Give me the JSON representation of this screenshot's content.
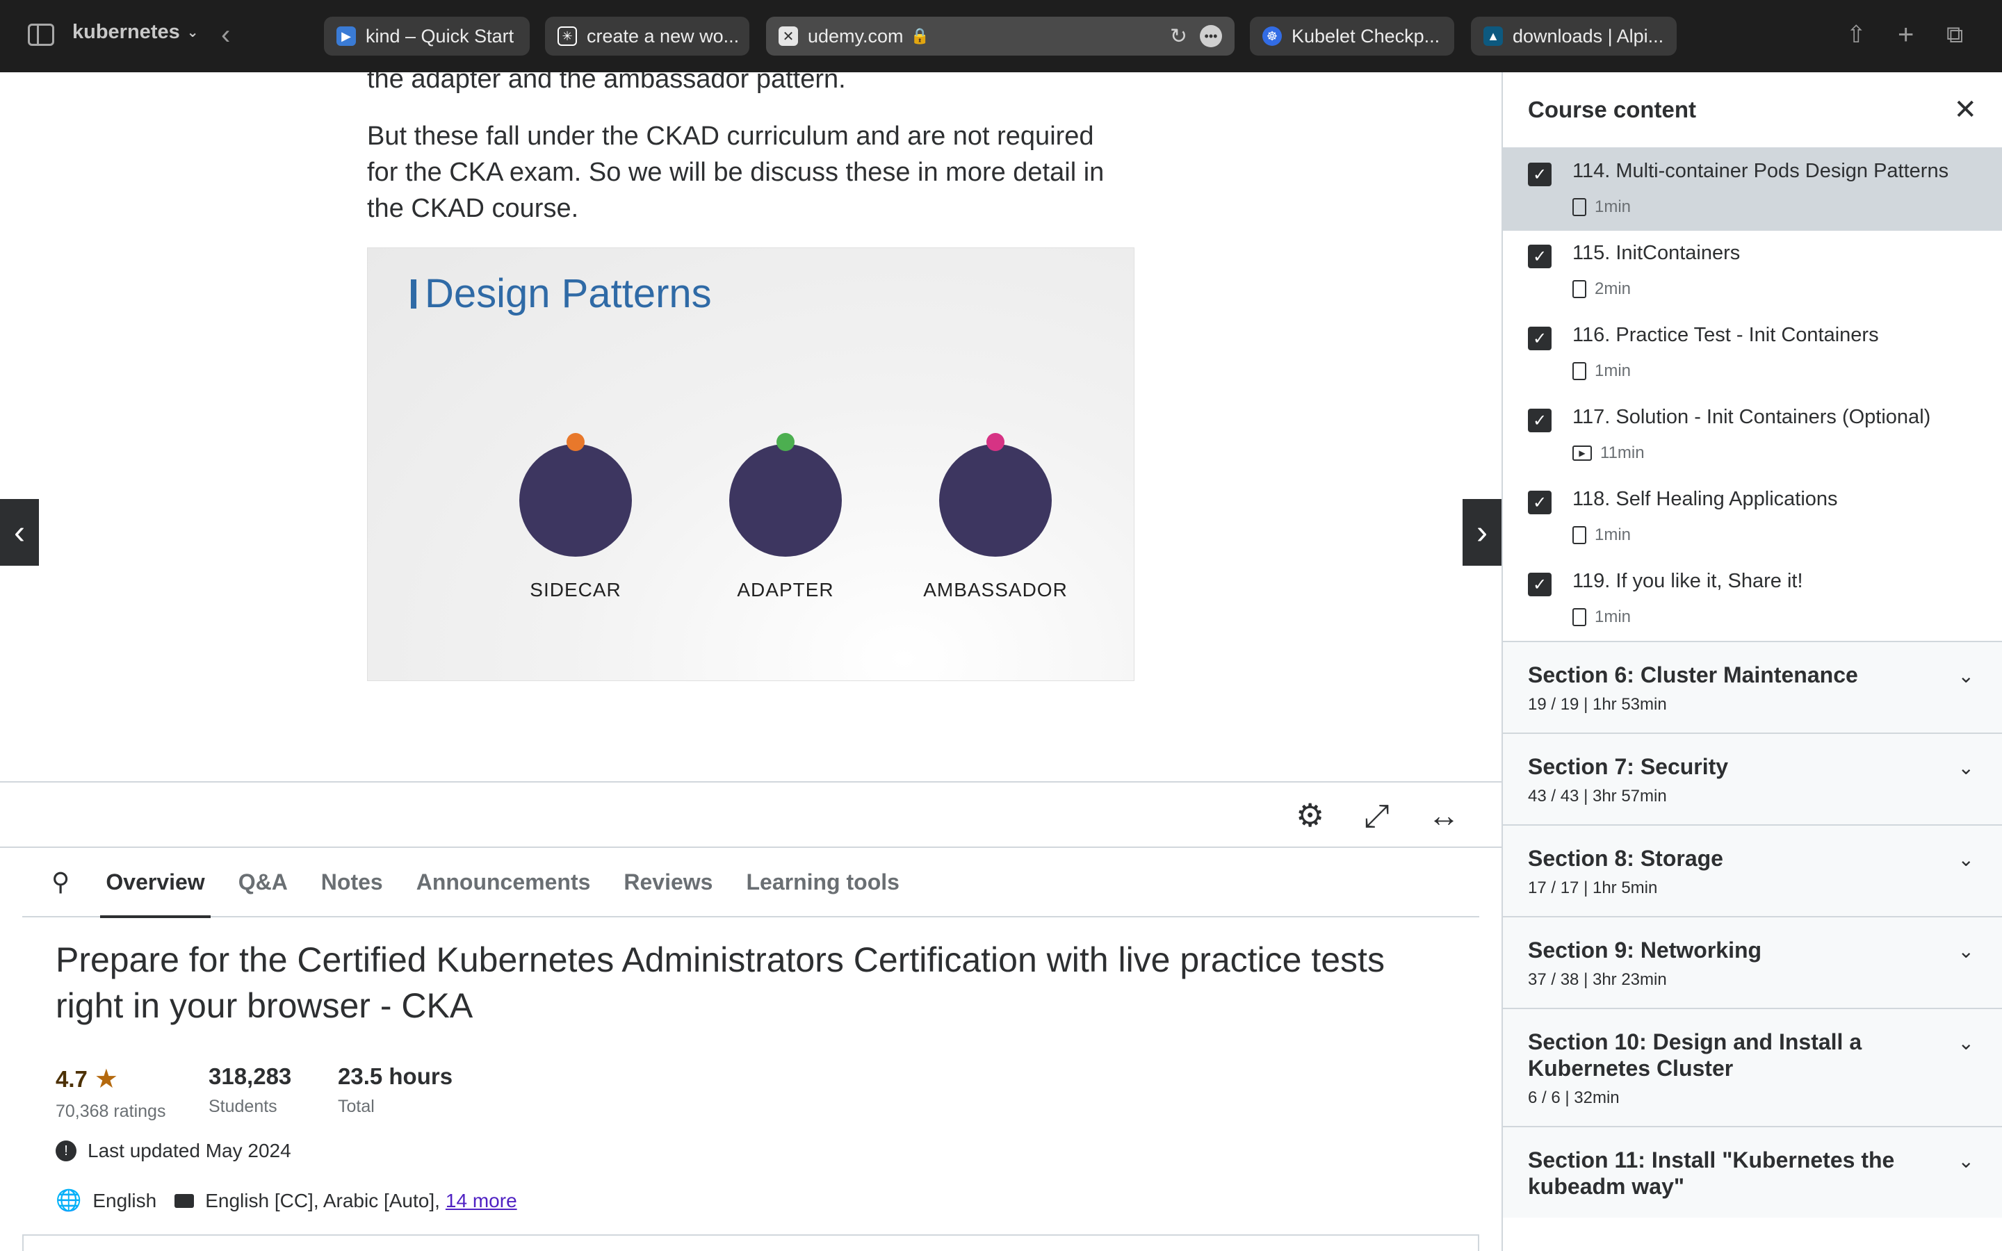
{
  "browser": {
    "tab_group": "kubernetes",
    "tabs": [
      {
        "label": "kind – Quick Start"
      },
      {
        "label": "create a new wo..."
      },
      {
        "label": "udemy.com"
      },
      {
        "label": "Kubelet Checkp..."
      },
      {
        "label": "downloads | Alpi..."
      }
    ]
  },
  "lecture": {
    "para_top": "the adapter and the ambassador pattern.",
    "para_main": "But these fall under the CKAD curriculum and are not required for the CKA exam. So we will be discuss these in more detail in the CKAD course.",
    "slide_title": "Design Patterns",
    "patterns": [
      {
        "label": "SIDECAR",
        "color": "#e8782b"
      },
      {
        "label": "ADAPTER",
        "color": "#4caf50"
      },
      {
        "label": "AMBASSADOR",
        "color": "#d63384"
      }
    ]
  },
  "course_tabs": [
    "Overview",
    "Q&A",
    "Notes",
    "Announcements",
    "Reviews",
    "Learning tools"
  ],
  "overview": {
    "title": "Prepare for the Certified Kubernetes Administrators Certification with live practice tests right in your browser - CKA",
    "rating": "4.7",
    "ratings_count": "70,368 ratings",
    "students": "318,283",
    "students_label": "Students",
    "hours": "23.5 hours",
    "hours_label": "Total",
    "last_updated": "Last updated May 2024",
    "language": "English",
    "captions": "English [CC], Arabic [Auto],",
    "captions_more": "14 more"
  },
  "sidebar": {
    "title": "Course content",
    "lectures": [
      {
        "title": "114. Multi-container Pods Design Patterns",
        "duration": "1min",
        "kind": "doc"
      },
      {
        "title": "115. InitContainers",
        "duration": "2min",
        "kind": "doc"
      },
      {
        "title": "116. Practice Test - Init Containers",
        "duration": "1min",
        "kind": "doc"
      },
      {
        "title": "117. Solution - Init Containers (Optional)",
        "duration": "11min",
        "kind": "video"
      },
      {
        "title": "118. Self Healing Applications",
        "duration": "1min",
        "kind": "doc"
      },
      {
        "title": "119. If you like it, Share it!",
        "duration": "1min",
        "kind": "doc"
      }
    ],
    "sections": [
      {
        "title": "Section 6: Cluster Maintenance",
        "sub": "19 / 19 | 1hr 53min"
      },
      {
        "title": "Section 7: Security",
        "sub": "43 / 43 | 3hr 57min"
      },
      {
        "title": "Section 8: Storage",
        "sub": "17 / 17 | 1hr 5min"
      },
      {
        "title": "Section 9: Networking",
        "sub": "37 / 38 | 3hr 23min"
      },
      {
        "title": "Section 10: Design and Install a Kubernetes Cluster",
        "sub": "6 / 6 | 32min"
      },
      {
        "title": "Section 11: Install \"Kubernetes the kubeadm way\"",
        "sub": ""
      }
    ]
  }
}
